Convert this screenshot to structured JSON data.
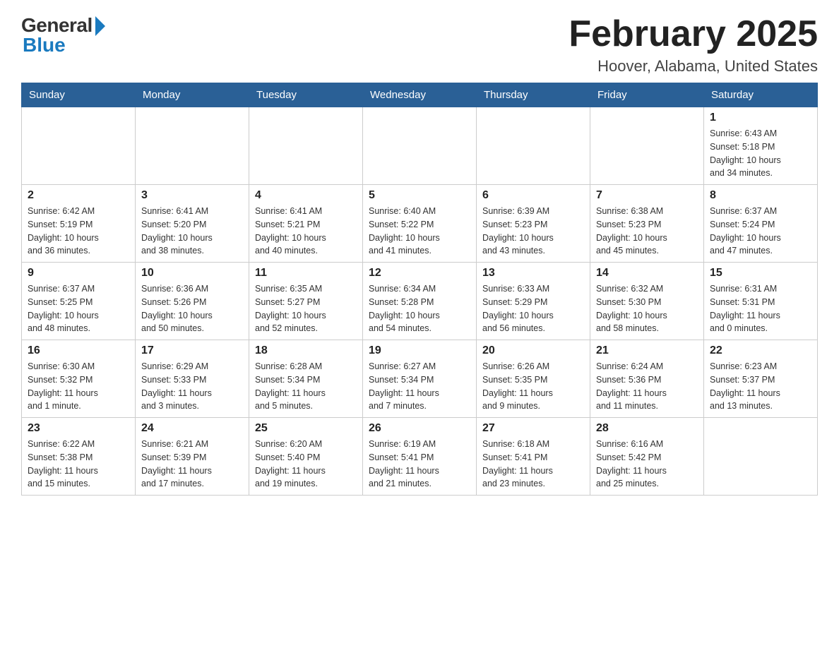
{
  "logo": {
    "general": "General",
    "blue": "Blue"
  },
  "header": {
    "title": "February 2025",
    "subtitle": "Hoover, Alabama, United States"
  },
  "weekdays": [
    "Sunday",
    "Monday",
    "Tuesday",
    "Wednesday",
    "Thursday",
    "Friday",
    "Saturday"
  ],
  "weeks": [
    [
      {
        "day": "",
        "info": ""
      },
      {
        "day": "",
        "info": ""
      },
      {
        "day": "",
        "info": ""
      },
      {
        "day": "",
        "info": ""
      },
      {
        "day": "",
        "info": ""
      },
      {
        "day": "",
        "info": ""
      },
      {
        "day": "1",
        "info": "Sunrise: 6:43 AM\nSunset: 5:18 PM\nDaylight: 10 hours\nand 34 minutes."
      }
    ],
    [
      {
        "day": "2",
        "info": "Sunrise: 6:42 AM\nSunset: 5:19 PM\nDaylight: 10 hours\nand 36 minutes."
      },
      {
        "day": "3",
        "info": "Sunrise: 6:41 AM\nSunset: 5:20 PM\nDaylight: 10 hours\nand 38 minutes."
      },
      {
        "day": "4",
        "info": "Sunrise: 6:41 AM\nSunset: 5:21 PM\nDaylight: 10 hours\nand 40 minutes."
      },
      {
        "day": "5",
        "info": "Sunrise: 6:40 AM\nSunset: 5:22 PM\nDaylight: 10 hours\nand 41 minutes."
      },
      {
        "day": "6",
        "info": "Sunrise: 6:39 AM\nSunset: 5:23 PM\nDaylight: 10 hours\nand 43 minutes."
      },
      {
        "day": "7",
        "info": "Sunrise: 6:38 AM\nSunset: 5:23 PM\nDaylight: 10 hours\nand 45 minutes."
      },
      {
        "day": "8",
        "info": "Sunrise: 6:37 AM\nSunset: 5:24 PM\nDaylight: 10 hours\nand 47 minutes."
      }
    ],
    [
      {
        "day": "9",
        "info": "Sunrise: 6:37 AM\nSunset: 5:25 PM\nDaylight: 10 hours\nand 48 minutes."
      },
      {
        "day": "10",
        "info": "Sunrise: 6:36 AM\nSunset: 5:26 PM\nDaylight: 10 hours\nand 50 minutes."
      },
      {
        "day": "11",
        "info": "Sunrise: 6:35 AM\nSunset: 5:27 PM\nDaylight: 10 hours\nand 52 minutes."
      },
      {
        "day": "12",
        "info": "Sunrise: 6:34 AM\nSunset: 5:28 PM\nDaylight: 10 hours\nand 54 minutes."
      },
      {
        "day": "13",
        "info": "Sunrise: 6:33 AM\nSunset: 5:29 PM\nDaylight: 10 hours\nand 56 minutes."
      },
      {
        "day": "14",
        "info": "Sunrise: 6:32 AM\nSunset: 5:30 PM\nDaylight: 10 hours\nand 58 minutes."
      },
      {
        "day": "15",
        "info": "Sunrise: 6:31 AM\nSunset: 5:31 PM\nDaylight: 11 hours\nand 0 minutes."
      }
    ],
    [
      {
        "day": "16",
        "info": "Sunrise: 6:30 AM\nSunset: 5:32 PM\nDaylight: 11 hours\nand 1 minute."
      },
      {
        "day": "17",
        "info": "Sunrise: 6:29 AM\nSunset: 5:33 PM\nDaylight: 11 hours\nand 3 minutes."
      },
      {
        "day": "18",
        "info": "Sunrise: 6:28 AM\nSunset: 5:34 PM\nDaylight: 11 hours\nand 5 minutes."
      },
      {
        "day": "19",
        "info": "Sunrise: 6:27 AM\nSunset: 5:34 PM\nDaylight: 11 hours\nand 7 minutes."
      },
      {
        "day": "20",
        "info": "Sunrise: 6:26 AM\nSunset: 5:35 PM\nDaylight: 11 hours\nand 9 minutes."
      },
      {
        "day": "21",
        "info": "Sunrise: 6:24 AM\nSunset: 5:36 PM\nDaylight: 11 hours\nand 11 minutes."
      },
      {
        "day": "22",
        "info": "Sunrise: 6:23 AM\nSunset: 5:37 PM\nDaylight: 11 hours\nand 13 minutes."
      }
    ],
    [
      {
        "day": "23",
        "info": "Sunrise: 6:22 AM\nSunset: 5:38 PM\nDaylight: 11 hours\nand 15 minutes."
      },
      {
        "day": "24",
        "info": "Sunrise: 6:21 AM\nSunset: 5:39 PM\nDaylight: 11 hours\nand 17 minutes."
      },
      {
        "day": "25",
        "info": "Sunrise: 6:20 AM\nSunset: 5:40 PM\nDaylight: 11 hours\nand 19 minutes."
      },
      {
        "day": "26",
        "info": "Sunrise: 6:19 AM\nSunset: 5:41 PM\nDaylight: 11 hours\nand 21 minutes."
      },
      {
        "day": "27",
        "info": "Sunrise: 6:18 AM\nSunset: 5:41 PM\nDaylight: 11 hours\nand 23 minutes."
      },
      {
        "day": "28",
        "info": "Sunrise: 6:16 AM\nSunset: 5:42 PM\nDaylight: 11 hours\nand 25 minutes."
      },
      {
        "day": "",
        "info": ""
      }
    ]
  ]
}
